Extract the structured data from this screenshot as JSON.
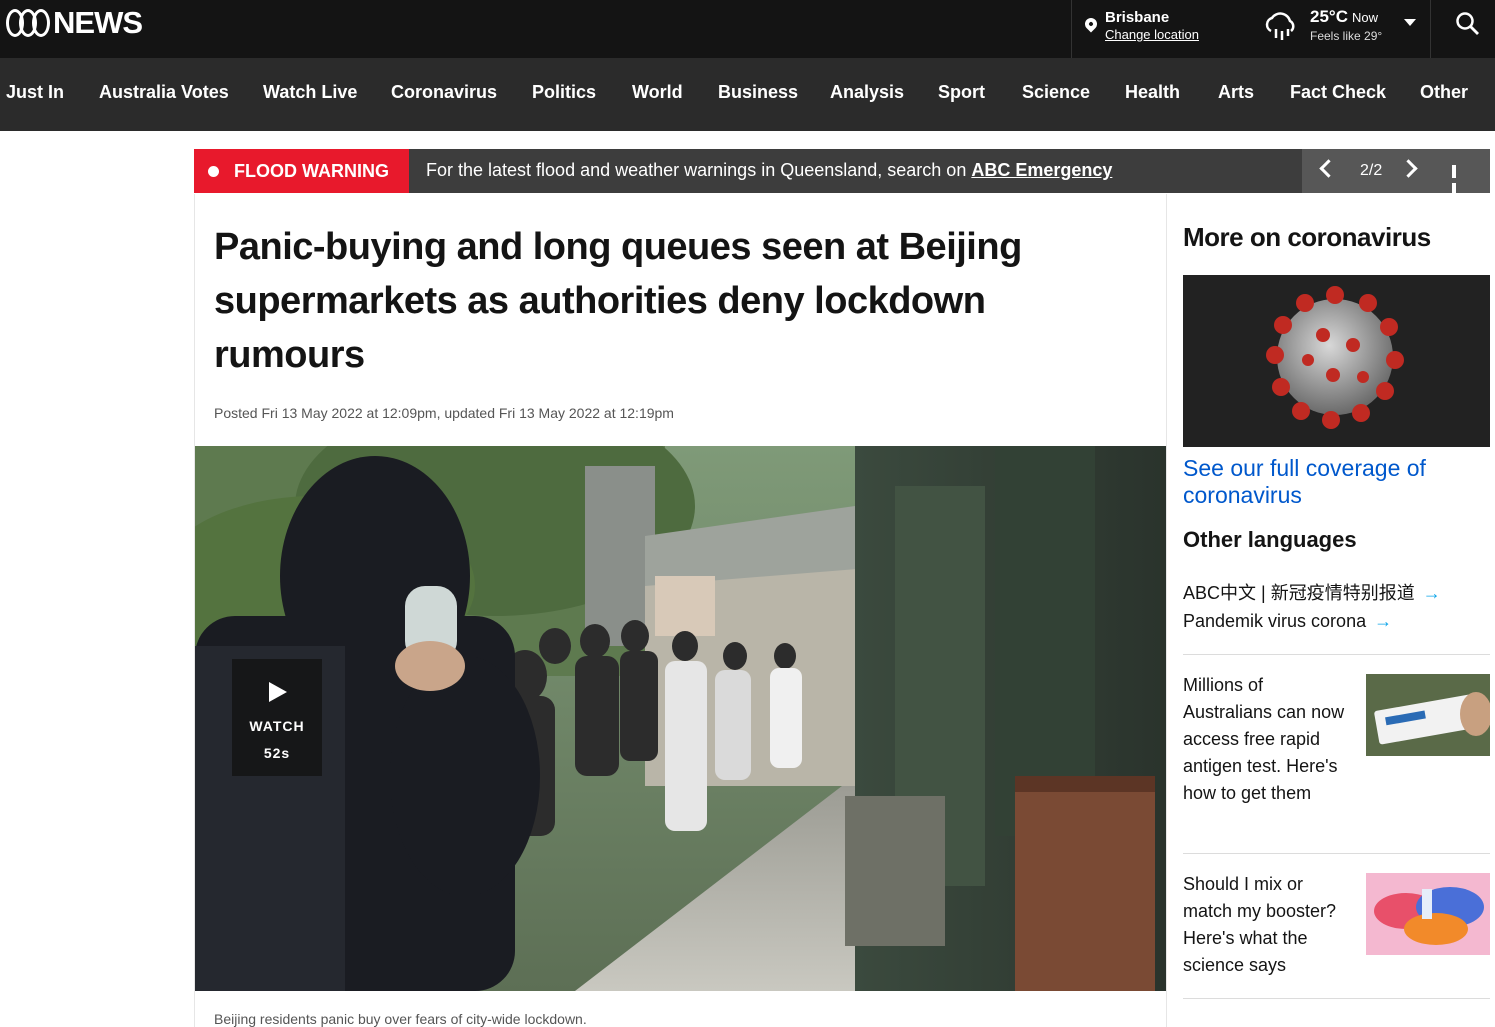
{
  "header": {
    "logo_text": "NEWS",
    "location": {
      "city": "Brisbane",
      "change_label": "Change location"
    },
    "weather": {
      "temp": "25°C",
      "now_label": "Now",
      "feels_like": "Feels like 29°"
    }
  },
  "nav": {
    "items": [
      "Just In",
      "Australia Votes",
      "Watch Live",
      "Coronavirus",
      "Politics",
      "World",
      "Business",
      "Analysis",
      "Sport",
      "Science",
      "Health",
      "Arts",
      "Fact Check",
      "Other"
    ]
  },
  "alert": {
    "label": "FLOOD WARNING",
    "message": "For the latest flood and weather warnings in Queensland, search on ",
    "link_text": "ABC Emergency",
    "counter": "2/2"
  },
  "article": {
    "headline": "Panic-buying and long queues seen at Beijing supermarkets as authorities deny lockdown rumours",
    "posted_label": "Posted ",
    "posted_date": "Fri 13 May 2022 at 12:09pm",
    "updated_label": ", updated ",
    "updated_date": "Fri 13 May 2022 at 12:19pm",
    "watch_label": "WATCH",
    "watch_duration": "52s",
    "caption": "Beijing residents panic buy over fears of city-wide lockdown."
  },
  "sidebar": {
    "title": "More on coronavirus",
    "coverage_link": "See our full coverage of coronavirus",
    "other_languages_title": "Other languages",
    "languages": [
      "ABC中文 | 新冠疫情特别报道",
      "Pandemik virus corona"
    ],
    "stories": [
      {
        "title": "Millions of Australians can now access free rapid antigen test. Here's how to get them"
      },
      {
        "title": "Should I mix or match my booster? Here's what the science says"
      }
    ]
  },
  "colors": {
    "topbar": "#141414",
    "navbar": "#2b2b2b",
    "alert_red": "#e8192c",
    "link_blue": "#0058cc",
    "arrow_blue": "#0ea5e9"
  }
}
